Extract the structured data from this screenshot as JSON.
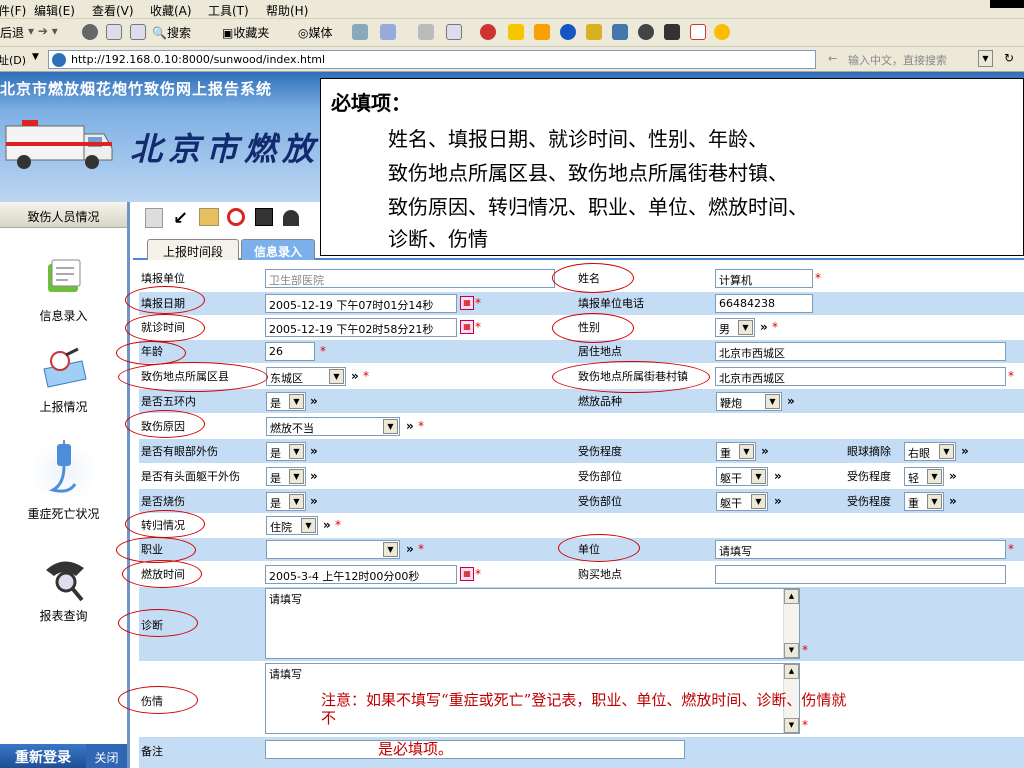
{
  "browser": {
    "menu": [
      "件(F)",
      "编辑(E)",
      "查看(V)",
      "收藏(A)",
      "工具(T)",
      "帮助(H)"
    ],
    "toolbar": {
      "back": "后退",
      "search": "搜索",
      "favorites": "收藏夹",
      "media": "媒体"
    },
    "address_label": "址(D)",
    "url": "http://192.168.0.10:8000/sunwood/index.html",
    "search_placeholder": "输入中文，直接搜索"
  },
  "banner": {
    "system_title": "北京市燃放烟花炮竹致伤网上报告系统",
    "big_title": "北京市燃放"
  },
  "sidebar": {
    "header": "致伤人员情况",
    "items": [
      {
        "label": "信息录入",
        "icon": "notebook-icon"
      },
      {
        "label": "上报情况",
        "icon": "folder-report-icon"
      },
      {
        "label": "重症死亡状况",
        "icon": "iv-drip-icon"
      },
      {
        "label": "报表查询",
        "icon": "magnifier-icon"
      }
    ],
    "relogin": "重新登录",
    "close": "关闭"
  },
  "tabs": [
    "上报时间段",
    "信息录入"
  ],
  "form": {
    "report_unit": {
      "label": "填报单位",
      "value": "卫生部医院"
    },
    "name": {
      "label": "姓名",
      "value": "计算机"
    },
    "report_date": {
      "label": "填报日期",
      "value": "2005-12-19 下午07时01分14秒"
    },
    "phone": {
      "label": "填报单位电话",
      "value": "66484238"
    },
    "visit_time": {
      "label": "就诊时间",
      "value": "2005-12-19 下午02时58分21秒"
    },
    "gender": {
      "label": "性别",
      "value": "男"
    },
    "age": {
      "label": "年龄",
      "value": "26"
    },
    "residence": {
      "label": "居住地点",
      "value": "北京市西城区"
    },
    "district": {
      "label": "致伤地点所属区县",
      "value": "东城区"
    },
    "street": {
      "label": "致伤地点所属街巷村镇",
      "value": "北京市西城区"
    },
    "fifth_ring": {
      "label": "是否五环内",
      "value": "是"
    },
    "firework_type": {
      "label": "燃放品种",
      "value": "鞭炮"
    },
    "cause": {
      "label": "致伤原因",
      "value": "燃放不当"
    },
    "eye_injury": {
      "label": "是否有眼部外伤",
      "value": "是"
    },
    "eye_degree": {
      "label": "受伤程度",
      "value": "重"
    },
    "eye_removal": {
      "label": "眼球摘除",
      "value": "右眼"
    },
    "head_injury": {
      "label": "是否有头面躯干外伤",
      "value": "是"
    },
    "head_part": {
      "label": "受伤部位",
      "value": "躯干"
    },
    "head_degree": {
      "label": "受伤程度",
      "value": "轻"
    },
    "burn": {
      "label": "是否烧伤",
      "value": "是"
    },
    "burn_part": {
      "label": "受伤部位",
      "value": "躯干"
    },
    "burn_degree": {
      "label": "受伤程度",
      "value": "重"
    },
    "outcome": {
      "label": "转归情况",
      "value": "住院"
    },
    "occupation": {
      "label": "职业",
      "value": ""
    },
    "employer": {
      "label": "单位",
      "value": "请填写"
    },
    "firework_time": {
      "label": "燃放时间",
      "value": "2005-3-4 上午12时00分00秒"
    },
    "purchase_place": {
      "label": "购买地点",
      "value": ""
    },
    "diagnosis": {
      "label": "诊断",
      "value": "请填写"
    },
    "injury": {
      "label": "伤情",
      "value": "请填写"
    },
    "remarks": {
      "label": "备注",
      "value": ""
    }
  },
  "required_mark": "*",
  "arrow_mark": "»",
  "popup": {
    "heading": "必填项：",
    "lines": [
      "姓名、填报日期、就诊时间、性别、年龄、",
      "致伤地点所属区县、致伤地点所属街巷村镇、",
      "致伤原因、转归情况、职业、单位、燃放时间、",
      "诊断、伤情"
    ]
  },
  "note": {
    "line1": "注意：如果不填写“重症或死亡”登记表，职业、单位、燃放时间、诊断、伤情就",
    "line2": "不",
    "line3": "是必填项。"
  },
  "colors": {
    "row_light": "#ffffff",
    "row_blue": "#c5dcf5",
    "accent": "#4d86d1",
    "required": "#e00000",
    "annotation": "#d00000"
  }
}
